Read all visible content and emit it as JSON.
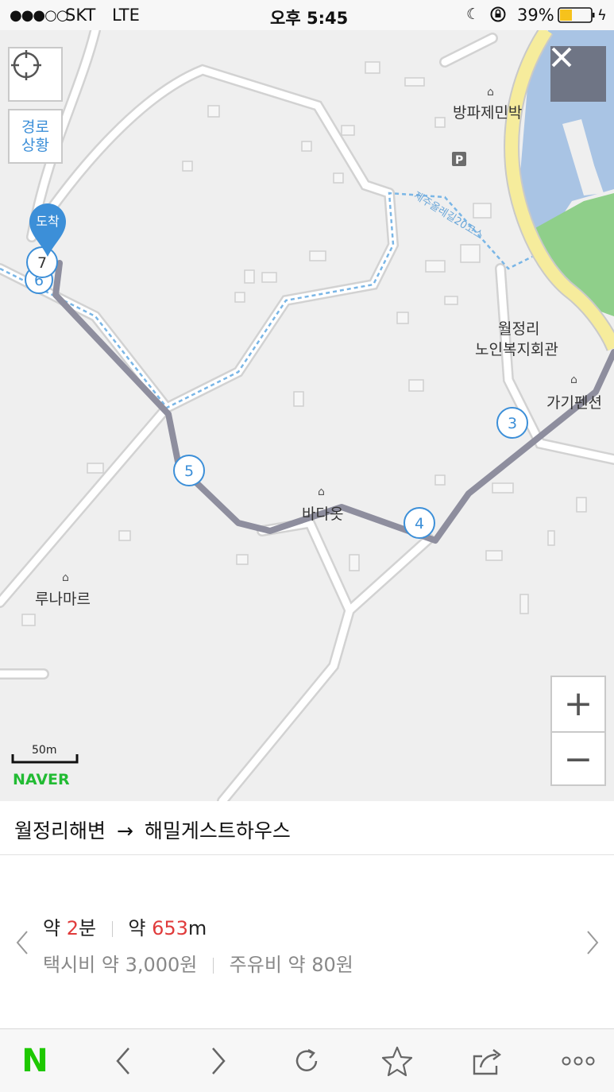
{
  "status_bar": {
    "signal": "●●●○○",
    "carrier": "SKT",
    "network": "LTE",
    "time": "오후 5:45",
    "battery": "39%",
    "battery_level": 0.39
  },
  "map": {
    "location_button_icon": "crosshair-icon",
    "route_status_label": "경로\n상황",
    "close_icon": "close-icon",
    "arrival_label": "도착",
    "waypoints": [
      "7",
      "6",
      "5",
      "4",
      "3"
    ],
    "pois": [
      "방파제민박",
      "월정리\n노인복지회관",
      "가기펜션",
      "루나마르",
      "바다옷"
    ],
    "road_label": "제주올레길20코스",
    "parking_label": "P",
    "zoom_in": "+",
    "zoom_out": "−",
    "scale_label": "50m",
    "brand": "NAVER",
    "colors": {
      "route": "#8e8e9e",
      "water": "#a9c4e4",
      "park": "#8fcf8a",
      "coast_road": "#f6ec9c",
      "accent": "#3c8fd8"
    }
  },
  "route": {
    "origin": "월정리해변",
    "arrow": "→",
    "destination": "해밀게스트하우스"
  },
  "summary": {
    "time_prefix": "약 ",
    "time_value": "2",
    "time_unit": "분",
    "dist_prefix": "약 ",
    "dist_value": "653",
    "dist_unit": "m",
    "taxi": "택시비 약 3,000원",
    "fuel": "주유비 약 80원",
    "highlight_color": "#e03b3b"
  },
  "toolbar": {
    "logo": "N",
    "icons": [
      "back-icon",
      "forward-icon",
      "refresh-icon",
      "bookmark-star-icon",
      "share-icon",
      "more-icon"
    ]
  }
}
